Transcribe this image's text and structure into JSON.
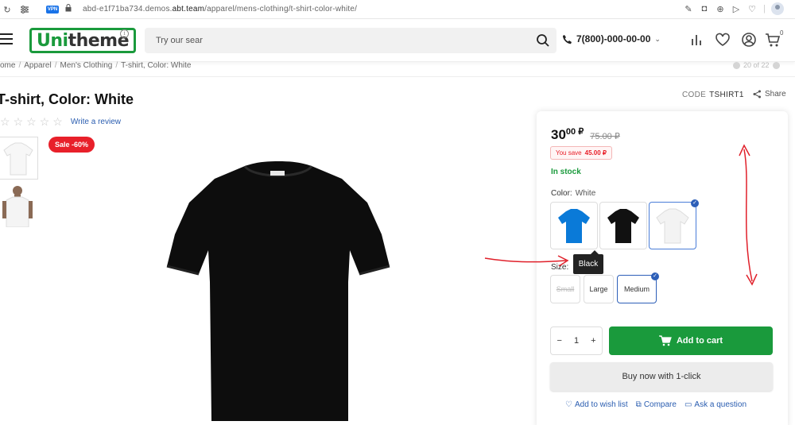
{
  "browser": {
    "url_prefix": "abd-e1f71ba734.demos.",
    "url_domain": "abt.team",
    "url_path": "/apparel/mens-clothing/t-shirt-color-white/",
    "vpn_label": "VPN"
  },
  "header": {
    "logo_brand": "Uni",
    "logo_rest": "theme",
    "search_placeholder": "Try our sear",
    "phone": "7(800)-000-00-00",
    "cart_count": "0"
  },
  "breadcrumb": [
    "ome",
    "Apparel",
    "Men's Clothing",
    "T-shirt, Color: White"
  ],
  "pager": "20 of 22",
  "product": {
    "title": "T-shirt, Color: White",
    "write_review": "Write a review",
    "code_label": "CODE",
    "code_value": "TSHIRT1",
    "share": "Share",
    "sale_badge": "Sale -60%",
    "rating": 0
  },
  "buy": {
    "price_main": "30",
    "price_kop": "00 ₽",
    "price_old": "75.00 ₽",
    "save_label": "You save",
    "save_value": "45.00 ₽",
    "stock": "In stock",
    "color_label": "Color:",
    "color_value": "White",
    "colors": [
      "blue",
      "black",
      "white"
    ],
    "size_label": "Size:",
    "sizes": [
      "Small",
      "Large",
      "Medium"
    ],
    "qty": "1",
    "add_to_cart": "Add to cart",
    "buy_one_click": "Buy now with 1-click",
    "wish": "Add to wish list",
    "compare": "Compare",
    "ask": "Ask a question"
  },
  "tooltip": "Black",
  "colors": {
    "green": "#1a9a3c",
    "red": "#e8202a",
    "link": "#2a5db0",
    "annotation": "#e0202a"
  }
}
